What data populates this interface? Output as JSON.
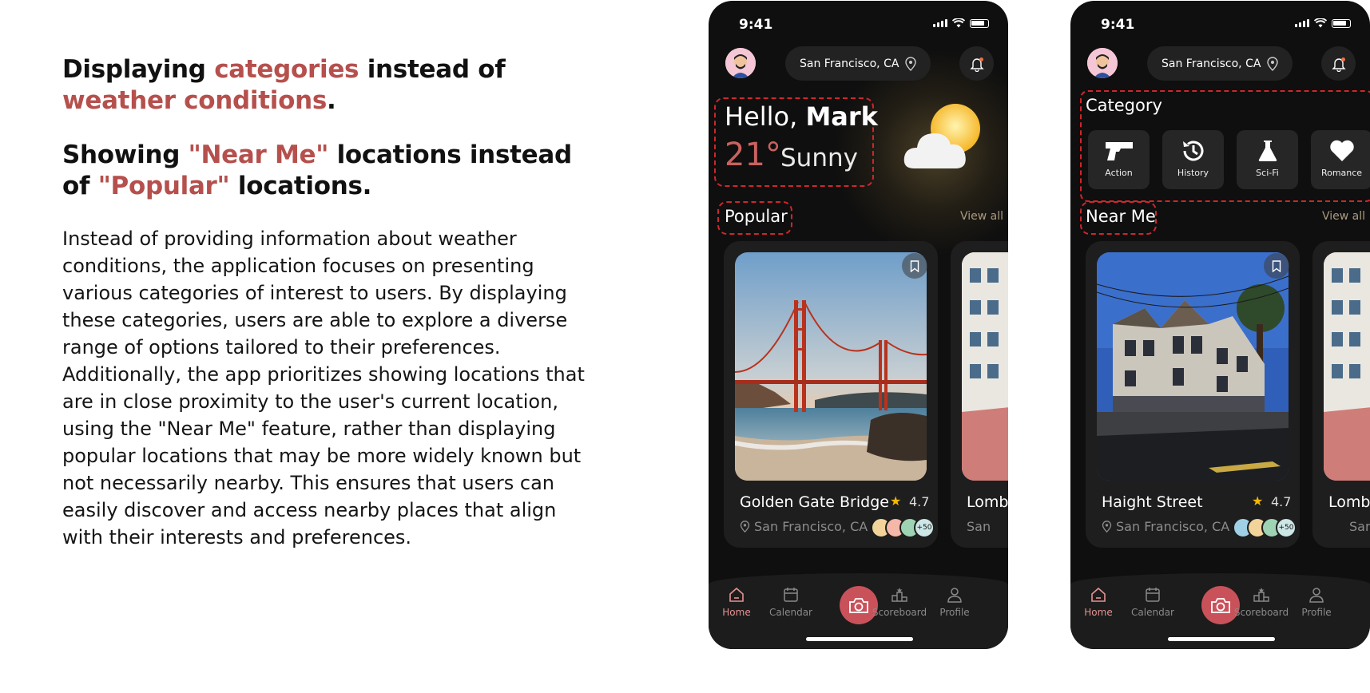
{
  "description": {
    "headline1": {
      "pre": "Displaying ",
      "hl1": "categories",
      "mid": " instead of ",
      "hl2": "weather conditions",
      "post": "."
    },
    "headline2": {
      "pre": "Showing ",
      "hl1": "\"Near Me\"",
      "mid": " locations instead of ",
      "hl2": "\"Popular\"",
      "post": " locations."
    },
    "paragraph": "Instead of providing information about weather conditions, the application focuses on presenting various categories of interest to users. By displaying these categories, users are able to explore a diverse range of options tailored to their preferences. Additionally, the app prioritizes showing locations that are in close proximity to the user's current location, using the \"Near Me\" feature, rather than displaying popular locations that may be more widely known but not necessarily nearby. This ensures that users can easily discover and access nearby places that align with their interests and preferences."
  },
  "colors": {
    "accent": "#b5504d",
    "highlight_border": "#d0262a",
    "phone_bg": "#0f0f0f",
    "card_bg": "#1e1e1e",
    "camera_button": "#c9525a",
    "active_tab": "#e59393"
  },
  "phone1": {
    "status_time": "9:41",
    "location": "San Francisco, CA",
    "greeting": "Hello,",
    "user_name": "Mark",
    "temperature": "21°",
    "condition": "Sunny",
    "section_title": "Popular",
    "view_all": "View all",
    "card": {
      "name": "Golden Gate Bridge",
      "rating": "4.7",
      "location": "San Francisco, CA",
      "visitors_more": "+50"
    },
    "card_next": {
      "name": "Lomb",
      "location": "San"
    }
  },
  "phone2": {
    "status_time": "9:41",
    "location": "San Francisco, CA",
    "category_title": "Category",
    "categories": [
      {
        "label": "Action",
        "icon": "gun-icon"
      },
      {
        "label": "History",
        "icon": "history-icon"
      },
      {
        "label": "Sci-Fi",
        "icon": "flask-icon"
      },
      {
        "label": "Romance",
        "icon": "heart-icon"
      }
    ],
    "section_title": "Near Me",
    "view_all": "View all",
    "card": {
      "name": "Haight Street",
      "rating": "4.7",
      "location": "San Francisco, CA",
      "visitors_more": "+50"
    },
    "card_next": {
      "name": "Lomb",
      "location": "San"
    }
  },
  "tabs": [
    {
      "label": "Home",
      "icon": "home-icon",
      "active": true
    },
    {
      "label": "Calendar",
      "icon": "calendar-icon"
    },
    {
      "label": "Camera",
      "icon": "camera-icon"
    },
    {
      "label": "Scoreboard",
      "icon": "scoreboard-icon"
    },
    {
      "label": "Profile",
      "icon": "profile-icon"
    }
  ]
}
